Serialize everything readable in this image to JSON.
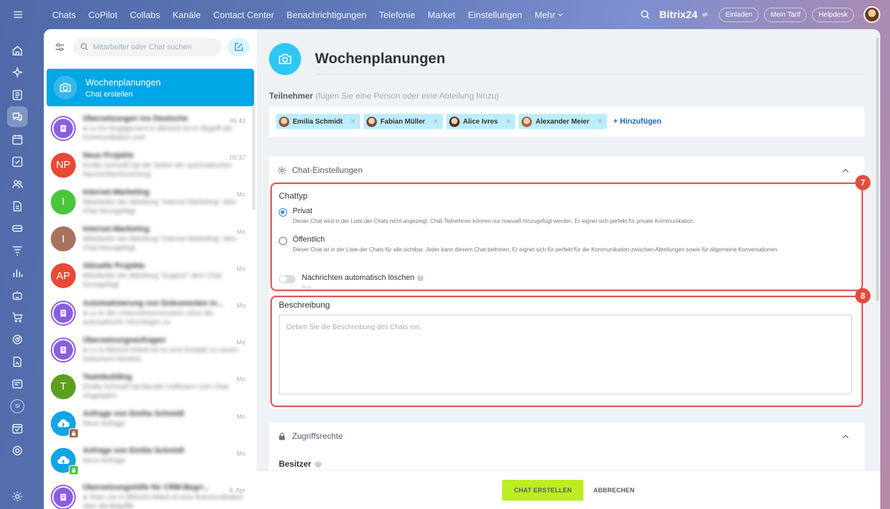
{
  "topbar": {
    "nav": [
      "Chats",
      "CoPilot",
      "Collabs",
      "Kanäle",
      "Contact Center",
      "Benachrichtigungen",
      "Telefonie",
      "Market",
      "Einstellungen",
      "Mehr"
    ],
    "brand": "Bitrix24",
    "buttons": [
      "Einladen",
      "Mein Tarif",
      "Helpdesk"
    ]
  },
  "rail": {
    "badge": "SI"
  },
  "chatlist": {
    "search_placeholder": "Mitarbeiter oder Chat suchen",
    "active": {
      "title": "Wochenplanungen",
      "subtitle": "Chat erstellen"
    },
    "rows": [
      {
        "name": "Übersetzungen ins Deutsche",
        "msg": "● Lo En Engagement in Bitrix24 ist im Begriff der Kommunikation und",
        "time": "05:43",
        "avatar": "purple",
        "initials": ""
      },
      {
        "name": "Neue Projekte",
        "msg": "Emilia Schmidt hat die Seiten der automatischen Nachrichtenforschung",
        "time": "05:37",
        "avatar": "red",
        "initials": "NP"
      },
      {
        "name": "Internet-Marketing",
        "msg": "Mitarbeiter der Abteilung \"Internet Marketing\" dem Chat hinzugefügt",
        "time": "Mo",
        "avatar": "green",
        "initials": "I"
      },
      {
        "name": "Internet-Marketing",
        "msg": "Mitarbeiter der Abteilung \"Internet Marketing\" dem Chat hinzugefügt",
        "time": "Mo",
        "avatar": "brown",
        "initials": "I"
      },
      {
        "name": "Aktuelle Projekte",
        "msg": "Mitarbeiter der Abteilung \"Support\" dem Chat hinzugefügt",
        "time": "Mo",
        "avatar": "red",
        "initials": "AP"
      },
      {
        "name": "Automatisierung von Dokumenten in...",
        "msg": "● Lo In der Unternehmensnutzen ohne die automatische Hinzufügen zu",
        "time": "Mo",
        "avatar": "purple",
        "initials": ""
      },
      {
        "name": "Übersetzungsanfragen",
        "msg": "● Lo In Bitrix24 Arbeit ist es eine Kontakt zu neuen Dokument handeln",
        "time": "Mo",
        "avatar": "purple",
        "initials": ""
      },
      {
        "name": "Teambuilding",
        "msg": "Emilia Schmidt hat Bender Hoffmann zum Chat eingeladen",
        "time": "Mo",
        "avatar": "olive",
        "initials": "T"
      },
      {
        "name": "Anfrage von Emilia Schmidt",
        "msg": "Neue Anfrage",
        "time": "Mo",
        "avatar": "cloud",
        "initials": "",
        "lock": "brown"
      },
      {
        "name": "Anfrage von Emilia Schmidt",
        "msg": "Neue Anfrage",
        "time": "Mo",
        "avatar": "cloud",
        "initials": "",
        "lock": "green"
      },
      {
        "name": "Übersetzungshilfe für CRM-Begri...",
        "msg": "● Team sur in Bitrix24 Arbeit ist eine Kommunikation über die Begriffe",
        "time": "8. Apr",
        "avatar": "purple",
        "initials": ""
      }
    ]
  },
  "main": {
    "title": "Wochenplanungen",
    "participants_label": "Teilnehmer",
    "participants_hint": "(fügen Sie eine Person oder eine Abteilung hinzu)",
    "participants": [
      "Emilia Schmidt",
      "Fabian Müller",
      "Alice Ivres",
      "Alexander Meier"
    ],
    "participant_colors": [
      "#8a5a3c",
      "#6e4a38",
      "#4b3226",
      "#a8623e"
    ],
    "add_label": "+ Hinzufügen",
    "settings": {
      "title": "Chat-Einstellungen",
      "chattype_label": "Chattyp",
      "private_title": "Privat",
      "private_desc": "Dieser Chat wird in der Liste der Chats nicht angezeigt. Chat-Teilnehmer können nur manuell hinzugefügt werden. Er eignet sich perfekt für private Kommunikation.",
      "public_title": "Öffentlich",
      "public_desc": "Dieser Chat ist in der Liste der Chats für alle sichtbar. Jeder kann diesem Chat beitreten. Er eignet sich für perfekt für die Kommunikation zwischen Abteilungen sowie für allgemeine Konversationen.",
      "autodelete_label": "Nachrichten automatisch löschen",
      "autodelete_state": "Aus",
      "description_label": "Beschreibung",
      "description_placeholder": "Geben Sie die Beschreibung des Chats ein.",
      "badges": [
        "7",
        "8"
      ]
    },
    "access": {
      "title": "Zugriffsrechte",
      "owner_label": "Besitzer"
    },
    "footer": {
      "create": "CHAT ERSTELLEN",
      "cancel": "ABBRECHEN"
    }
  },
  "colors": {
    "accent": "#00a7e7",
    "create_button": "#bbed21",
    "highlight": "#e05555"
  }
}
